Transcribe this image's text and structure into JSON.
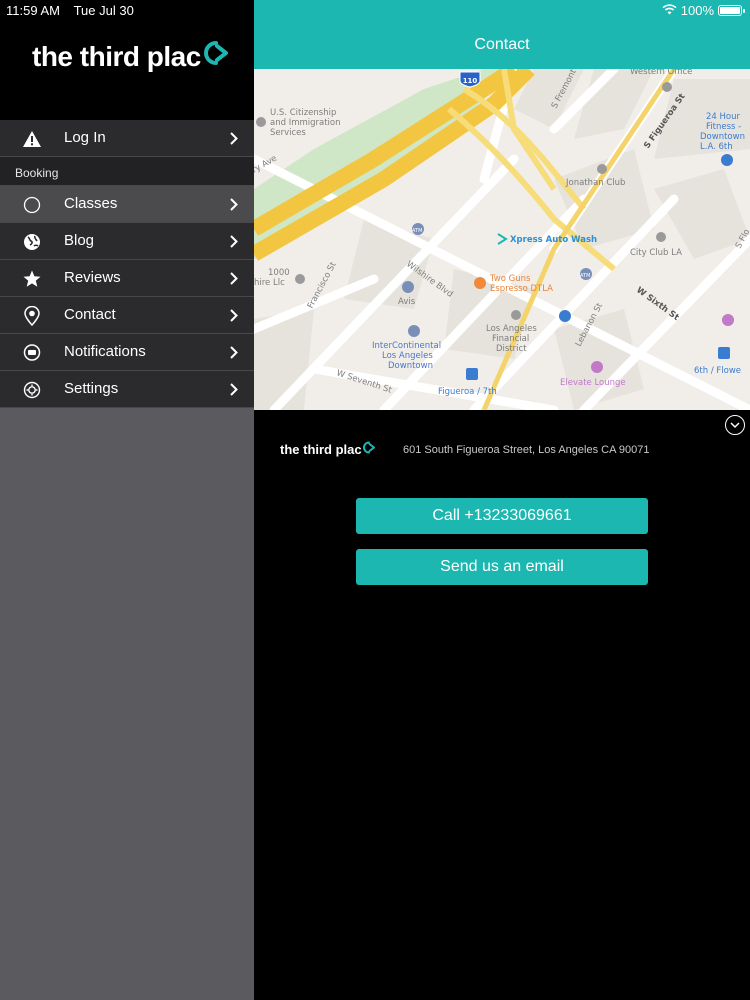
{
  "status": {
    "time": "11:59 AM",
    "date": "Tue Jul 30",
    "battery": "100%",
    "battery_level": 1.0
  },
  "brand": {
    "name": "the third plac",
    "accent": "#1bb7b0"
  },
  "sidebar": {
    "items_top": [
      {
        "label": "Log In",
        "icon": "warning-icon"
      }
    ],
    "section": "Booking",
    "items": [
      {
        "label": "Classes",
        "icon": "circle-icon",
        "active": true
      },
      {
        "label": "Blog",
        "icon": "globe-icon"
      },
      {
        "label": "Reviews",
        "icon": "star-icon"
      },
      {
        "label": "Contact",
        "icon": "location-pin-icon"
      },
      {
        "label": "Notifications",
        "icon": "chat-bubble-icon"
      },
      {
        "label": "Settings",
        "icon": "gear-icon"
      }
    ]
  },
  "header": {
    "title": "Contact"
  },
  "map": {
    "labels": {
      "citizenship": "U.S. Citizenship",
      "immigration": "and Immigration",
      "services": "Services",
      "western_office": "Western Office",
      "fremont": "S Fremont",
      "figueroa_st": "S Figueroa St",
      "fitness1": "24 Hour",
      "fitness2": "Fitness -",
      "fitness3": "Downtown",
      "fitness4": "L.A. 6th",
      "jonathan": "Jonathan Club",
      "xpress": "Xpress Auto Wash",
      "cityclub": "City Club LA",
      "wilshire": "Wilshire Blvd",
      "twoguns1": "Two Guns",
      "twoguns2": "Espresso DTLA",
      "avis": "Avis",
      "sixth": "W Sixth St",
      "francisco": "Francisco St",
      "lafin1": "Los Angeles",
      "lafin2": "Financial",
      "lafin3": "District",
      "inter1": "InterContinental",
      "inter2": "Los Angeles",
      "inter3": "Downtown",
      "lebanon": "Lebanon St",
      "elevate": "Elevate Lounge",
      "seventh": "W Seventh St",
      "fig7": "Figueroa / 7th",
      "flower": "6th / Flowe",
      "shield": "110",
      "atm": "ATM",
      "ave": "ry Ave",
      "llc1": "1000",
      "llc2": "hire Llc",
      "flo": "S Flo"
    }
  },
  "contact": {
    "logo_text": "the third plac",
    "address": "601 South Figueroa Street, Los Angeles CA 90071",
    "call_label": "Call +13233069661",
    "email_label": "Send us an email"
  }
}
